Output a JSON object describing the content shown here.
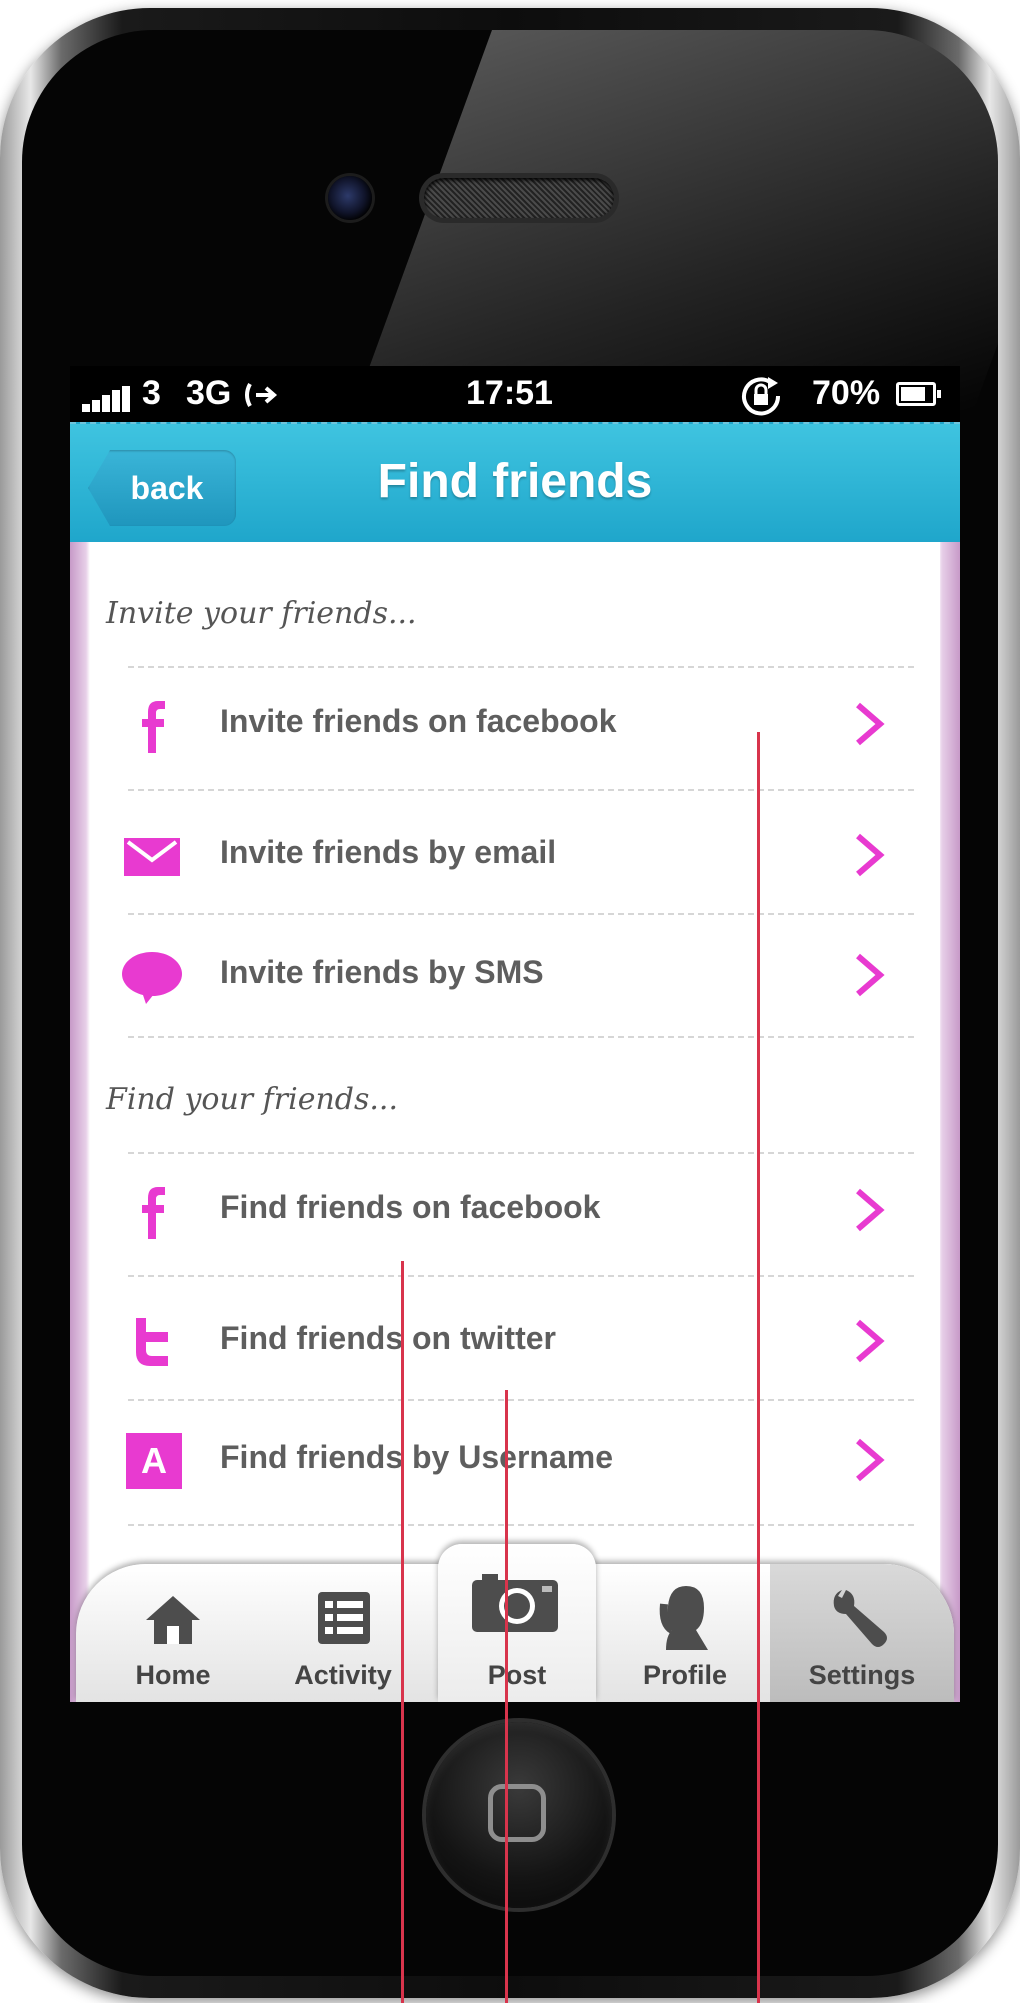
{
  "status_bar": {
    "carrier": "3",
    "network": "3G",
    "time": "17:51",
    "battery": "70%",
    "battery_level": 0.7
  },
  "nav": {
    "back_label": "back",
    "title": "Find friends"
  },
  "invite_section": {
    "heading": "Invite your friends...",
    "items": [
      {
        "label": "Invite friends on facebook",
        "icon": "facebook-icon"
      },
      {
        "label": "Invite friends by email",
        "icon": "email-icon"
      },
      {
        "label": "Invite friends by SMS",
        "icon": "sms-bubble-icon"
      }
    ]
  },
  "find_section": {
    "heading": "Find your friends...",
    "items": [
      {
        "label": "Find friends on facebook",
        "icon": "facebook-icon"
      },
      {
        "label": "Find friends on twitter",
        "icon": "twitter-icon"
      },
      {
        "label": "Find friends by Username",
        "icon": "username-icon",
        "icon_text": "A"
      }
    ]
  },
  "tabs": [
    {
      "label": "Home",
      "icon": "house-icon"
    },
    {
      "label": "Activity",
      "icon": "list-icon"
    },
    {
      "label": "Post",
      "icon": "camera-icon"
    },
    {
      "label": "Profile",
      "icon": "profile-icon"
    },
    {
      "label": "Settings",
      "icon": "wrench-icon",
      "selected": true
    }
  ],
  "colors": {
    "accent": "#e83ad0",
    "nav_bar": "#2eb4d6",
    "annotation": "#d8344c"
  }
}
